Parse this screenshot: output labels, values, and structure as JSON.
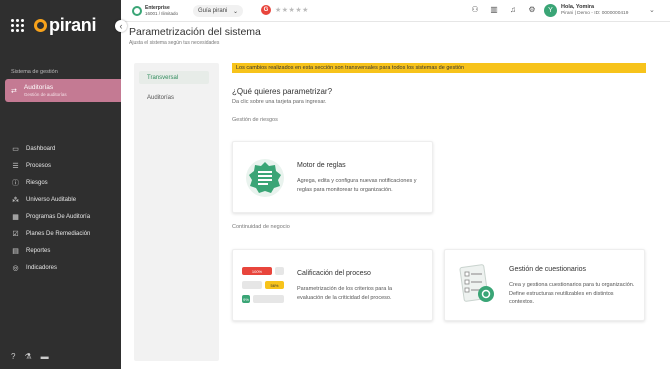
{
  "brand": {
    "logo_text": "pirani",
    "accent": "#f7a21b",
    "green": "#3aa576",
    "pink": "#c47a93"
  },
  "sidebar": {
    "section_label": "Sistema de gestión",
    "active": {
      "title": "Auditorías",
      "subtitle": "Gestión de auditorías"
    },
    "items": [
      {
        "label": "Dashboard",
        "icon": "monitor-icon"
      },
      {
        "label": "Procesos",
        "icon": "list-icon"
      },
      {
        "label": "Riesgos",
        "icon": "alert-icon"
      },
      {
        "label": "Universo Auditable",
        "icon": "nodes-icon"
      },
      {
        "label": "Programas De Auditoría",
        "icon": "calendar-icon"
      },
      {
        "label": "Planes De Remediación",
        "icon": "check-square-icon"
      },
      {
        "label": "Reportes",
        "icon": "report-icon"
      },
      {
        "label": "Indicadores",
        "icon": "target-icon"
      }
    ]
  },
  "topbar": {
    "plan_title": "Enterprise",
    "plan_sub": "16001 / Ilimitado",
    "guide_label": "Guía pirani",
    "rating_letter": "G",
    "stars": "★★★★★",
    "user_greeting": "Hola, Yomira",
    "user_detail": "Pirani | Demo - ID: 0000000419",
    "avatar_letter": "Y"
  },
  "main": {
    "title": "Parametrización del sistema",
    "subtitle": "Ajusta el sistema según tus necesidades",
    "tabs": [
      {
        "label": "Transversal"
      },
      {
        "label": "Auditorías"
      }
    ],
    "banner": "Los cambios realizados en esta sección son transversales para todos los sistemas de gestión",
    "question": "¿Qué quieres parametrizar?",
    "question_sub": "Da clic sobre una tarjeta para ingresar.",
    "section1": "Gestión de riesgos",
    "section2": "Continuidad de negocio",
    "cards": [
      {
        "title": "Motor de reglas",
        "desc": "Agrega, edita y configura nuevas notificaciones y reglas para monitorear tu organización."
      },
      {
        "title": "Calificación del proceso",
        "desc": "Parametrización de los criterios para la evaluación de la criticidad del proceso.",
        "bars": [
          "100%",
          "56%",
          "9%"
        ]
      },
      {
        "title": "Gestión de cuestionarios",
        "desc": "Crea y gestiona cuestionarios para tu organización. Define estructuras reutilizables en distintos contextos."
      }
    ]
  }
}
